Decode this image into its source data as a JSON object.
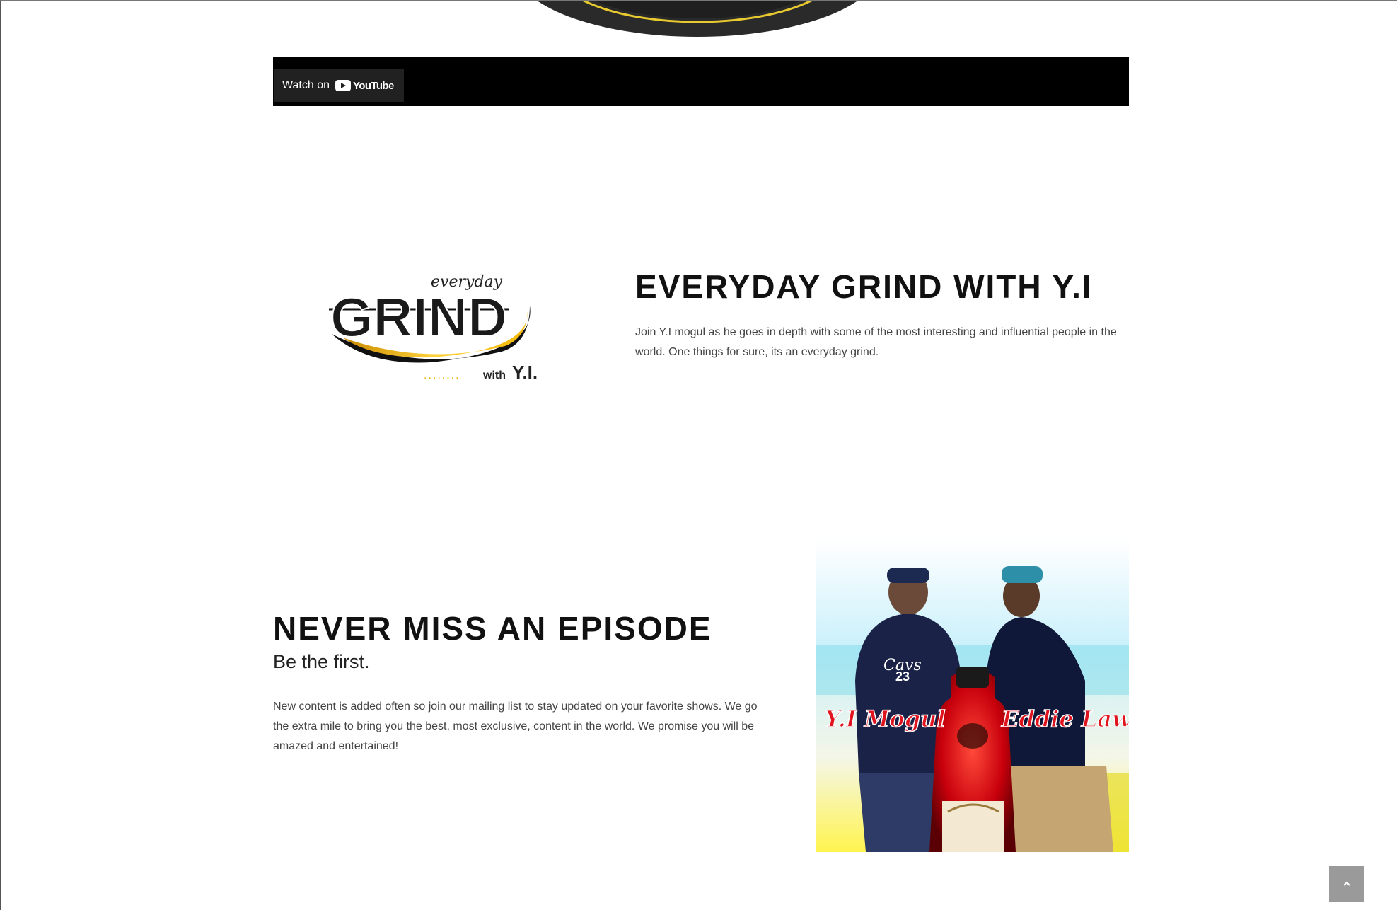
{
  "video": {
    "watch_on_label": "Watch on",
    "youtube_label": "YouTube"
  },
  "grind_section": {
    "logo": {
      "script_text": "everyday",
      "main_text": "GRIND",
      "with_text": "with",
      "name_text": "Y.I."
    },
    "heading": "EVERYDAY GRIND WITH Y.I",
    "paragraph": "Join Y.I mogul as he goes in depth with some of the most interesting and influential people in the world. One things for sure, its an everyday grind."
  },
  "episode_section": {
    "heading": "NEVER MISS AN EPISODE",
    "subheading": "Be the first.",
    "paragraph": "New content is added often so join our mailing list to stay updated on your favorite shows. We go the extra mile to bring you the best, most exclusive, content in the world. We promise you will be amazed and entertained!",
    "image": {
      "left_caption": "Y.I Mogul",
      "right_caption": "Eddie Law"
    }
  },
  "back_to_top": {
    "icon": "chevron-up-icon"
  },
  "colors": {
    "heading": "#111111",
    "body_text": "#444444",
    "video_bar": "#000000",
    "logo_swoosh": "#f2b705",
    "caption_red": "#e0141e"
  }
}
